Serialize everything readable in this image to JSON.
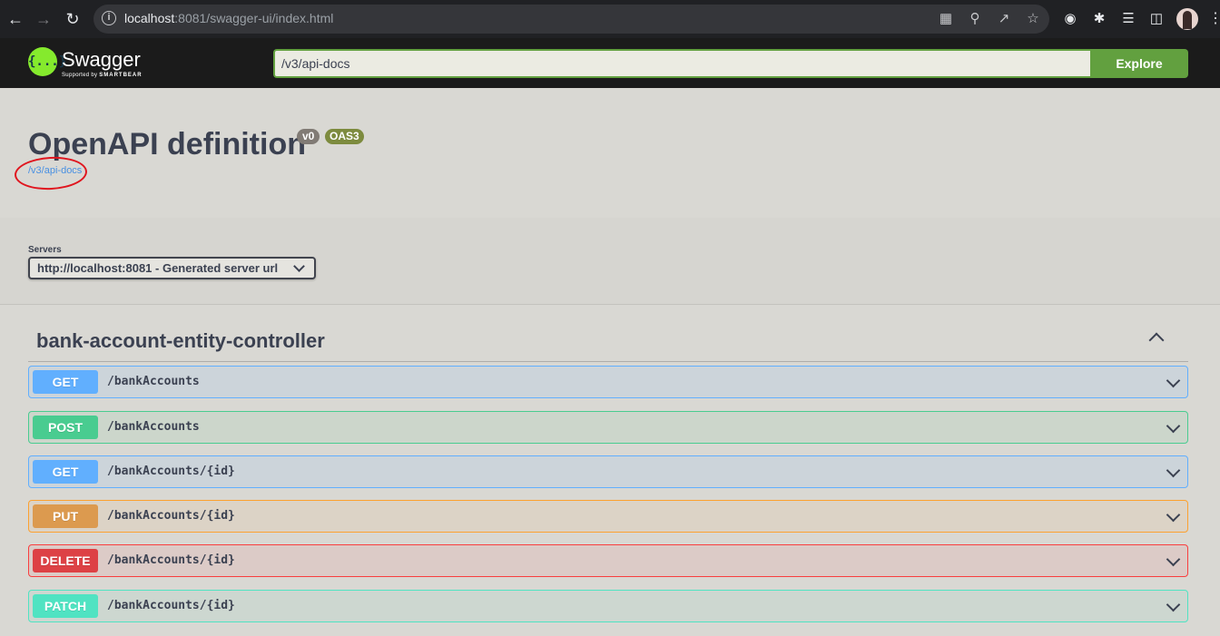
{
  "browser": {
    "url_host": "localhost",
    "url_rest": ":8081/swagger-ui/index.html"
  },
  "topbar": {
    "logo_name": "Swagger",
    "logo_mark": "{...}",
    "logo_supported": "Supported by",
    "logo_company": "SMARTBEAR",
    "url_value": "/v3/api-docs",
    "explore_label": "Explore"
  },
  "info": {
    "title": "OpenAPI definition",
    "version": "v0",
    "oas_badge": "OAS3",
    "spec_link": "/v3/api-docs"
  },
  "servers": {
    "label": "Servers",
    "selected": "http://localhost:8081 - Generated server url"
  },
  "tag": {
    "name": "bank-account-entity-controller"
  },
  "operations": [
    {
      "method": "GET",
      "path": "/bankAccounts"
    },
    {
      "method": "POST",
      "path": "/bankAccounts"
    },
    {
      "method": "GET",
      "path": "/bankAccounts/{id}"
    },
    {
      "method": "PUT",
      "path": "/bankAccounts/{id}"
    },
    {
      "method": "DELETE",
      "path": "/bankAccounts/{id}"
    },
    {
      "method": "PATCH",
      "path": "/bankAccounts/{id}"
    }
  ]
}
